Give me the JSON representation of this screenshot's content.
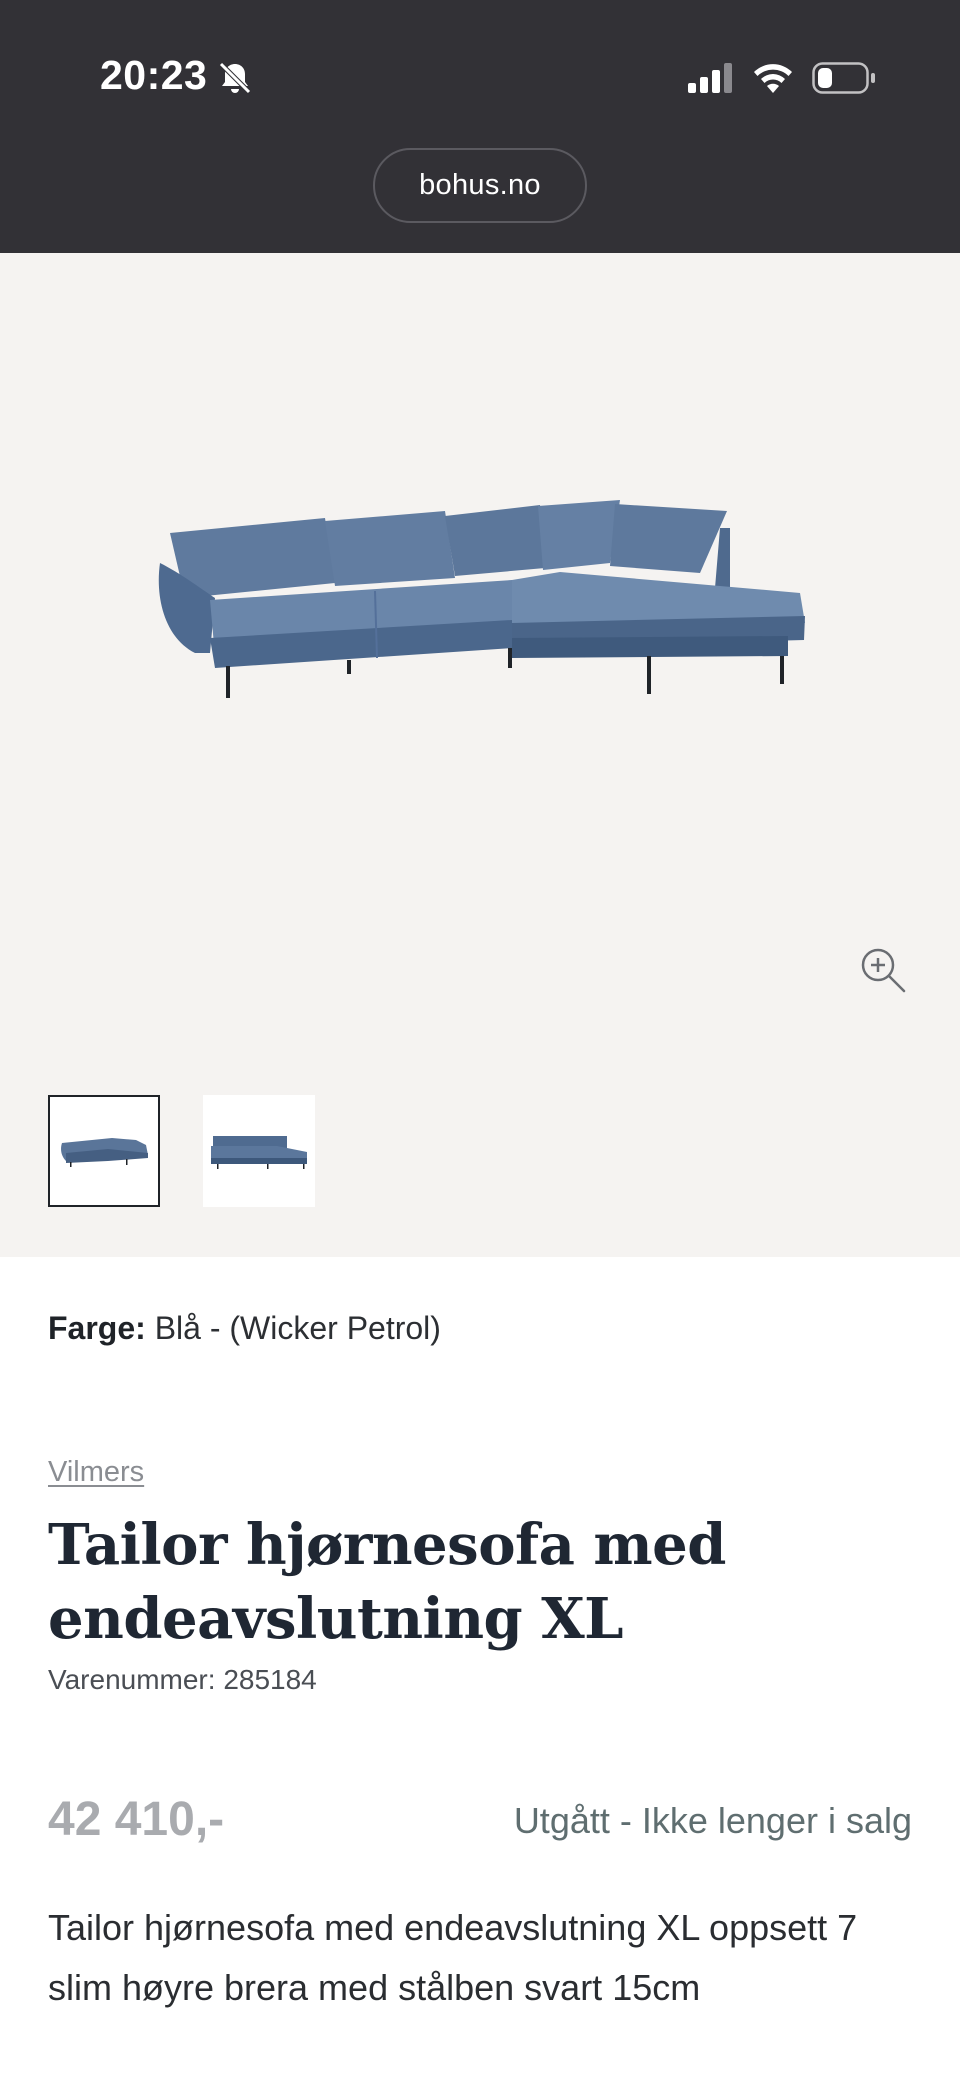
{
  "status_bar": {
    "time": "20:23",
    "icons": [
      "bell-muted-icon",
      "cellular-signal-icon",
      "wifi-icon",
      "battery-icon"
    ]
  },
  "browser": {
    "url": "bohus.no"
  },
  "gallery": {
    "main_image_alt": "sofa-image",
    "zoom_icon": "zoom-in-icon",
    "thumbnails": [
      "thumbnail-1",
      "thumbnail-2"
    ],
    "active_thumbnail": 0
  },
  "product": {
    "color_label": "Farge:",
    "color_value": "Blå - (Wicker Petrol)",
    "brand": "Vilmers",
    "title": "Tailor hjørnesofa med endeavslutning XL",
    "sku": "Varenummer: 285184",
    "price": "42 410,-",
    "availability": "Utgått - Ikke lenger i salg",
    "description": "Tailor hjørnesofa med endeavslutning XL oppsett 7 slim høyre brera med stålben svart 15cm"
  },
  "colors": {
    "topbar": "#323136",
    "gallery_bg": "#f5f3f1",
    "sofa": "#5a7599",
    "price": "#a9abaf",
    "availability": "#5f6e70"
  }
}
